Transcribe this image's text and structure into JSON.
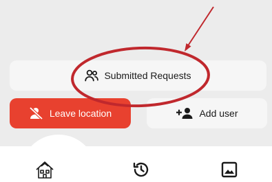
{
  "actions": {
    "submitted_requests": "Submitted Requests",
    "leave_location": "Leave location",
    "add_user": "Add user"
  },
  "nav": {
    "items": [
      {
        "icon": "home-community-icon"
      },
      {
        "icon": "history-icon"
      },
      {
        "icon": "gallery-icon"
      }
    ]
  },
  "colors": {
    "accent_red": "#e8412f",
    "annotation_red": "#c0282d",
    "panel_gray": "#ececec",
    "button_bg": "#f6f6f6"
  }
}
